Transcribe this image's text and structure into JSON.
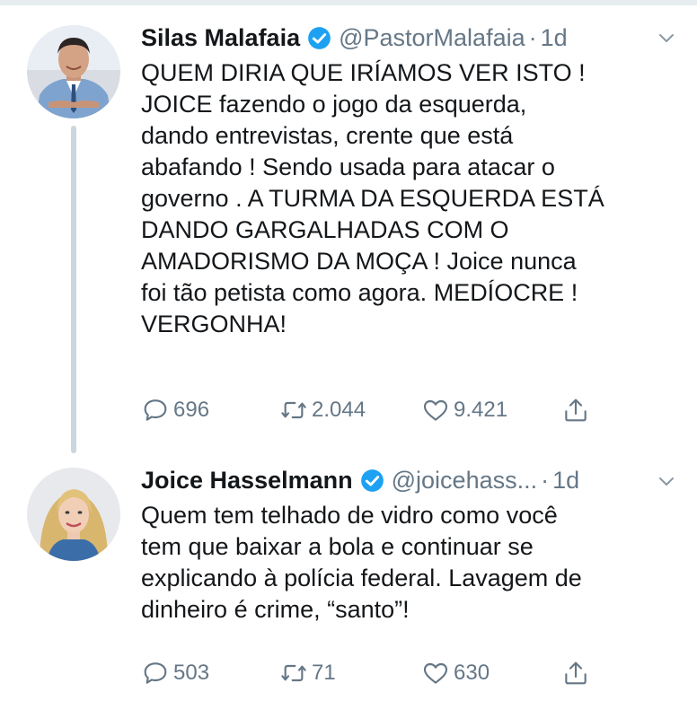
{
  "tweets": [
    {
      "name": "Silas Malafaia",
      "handle": "@PastorMalafaia",
      "separator": "·",
      "age": "1d",
      "lines": [
        "QUEM DIRIA QUE IRÍAMOS VER ISTO !",
        "JOICE fazendo o jogo da esquerda,",
        "dando entrevistas, crente que está",
        "abafando ! Sendo usada para atacar o",
        "governo . A TURMA DA ESQUERDA ESTÁ",
        "DANDO GARGALHADAS COM O",
        "AMADORISMO DA MOÇA ! Joice nunca",
        "foi tão petista como agora. MEDÍOCRE !",
        "VERGONHA!"
      ],
      "replies": "696",
      "retweets": "2.044",
      "likes": "9.421"
    },
    {
      "name": "Joice Hasselmann",
      "handle": "@joicehass...",
      "separator": "·",
      "age": "1d",
      "lines": [
        "Quem tem telhado de vidro como você",
        "tem que baixar a bola e continuar se",
        "explicando à polícia federal. Lavagem de",
        "dinheiro é crime, “santo”!"
      ],
      "replies": "503",
      "retweets": "71",
      "likes": "630"
    }
  ],
  "colors": {
    "verified": "#1da1f2",
    "text": "#14171a",
    "secondary": "#657786",
    "thread_line": "#ccd6dd"
  },
  "icons": [
    "verified-badge-icon",
    "caret-down-icon",
    "reply-icon",
    "retweet-icon",
    "like-icon",
    "share-icon"
  ]
}
